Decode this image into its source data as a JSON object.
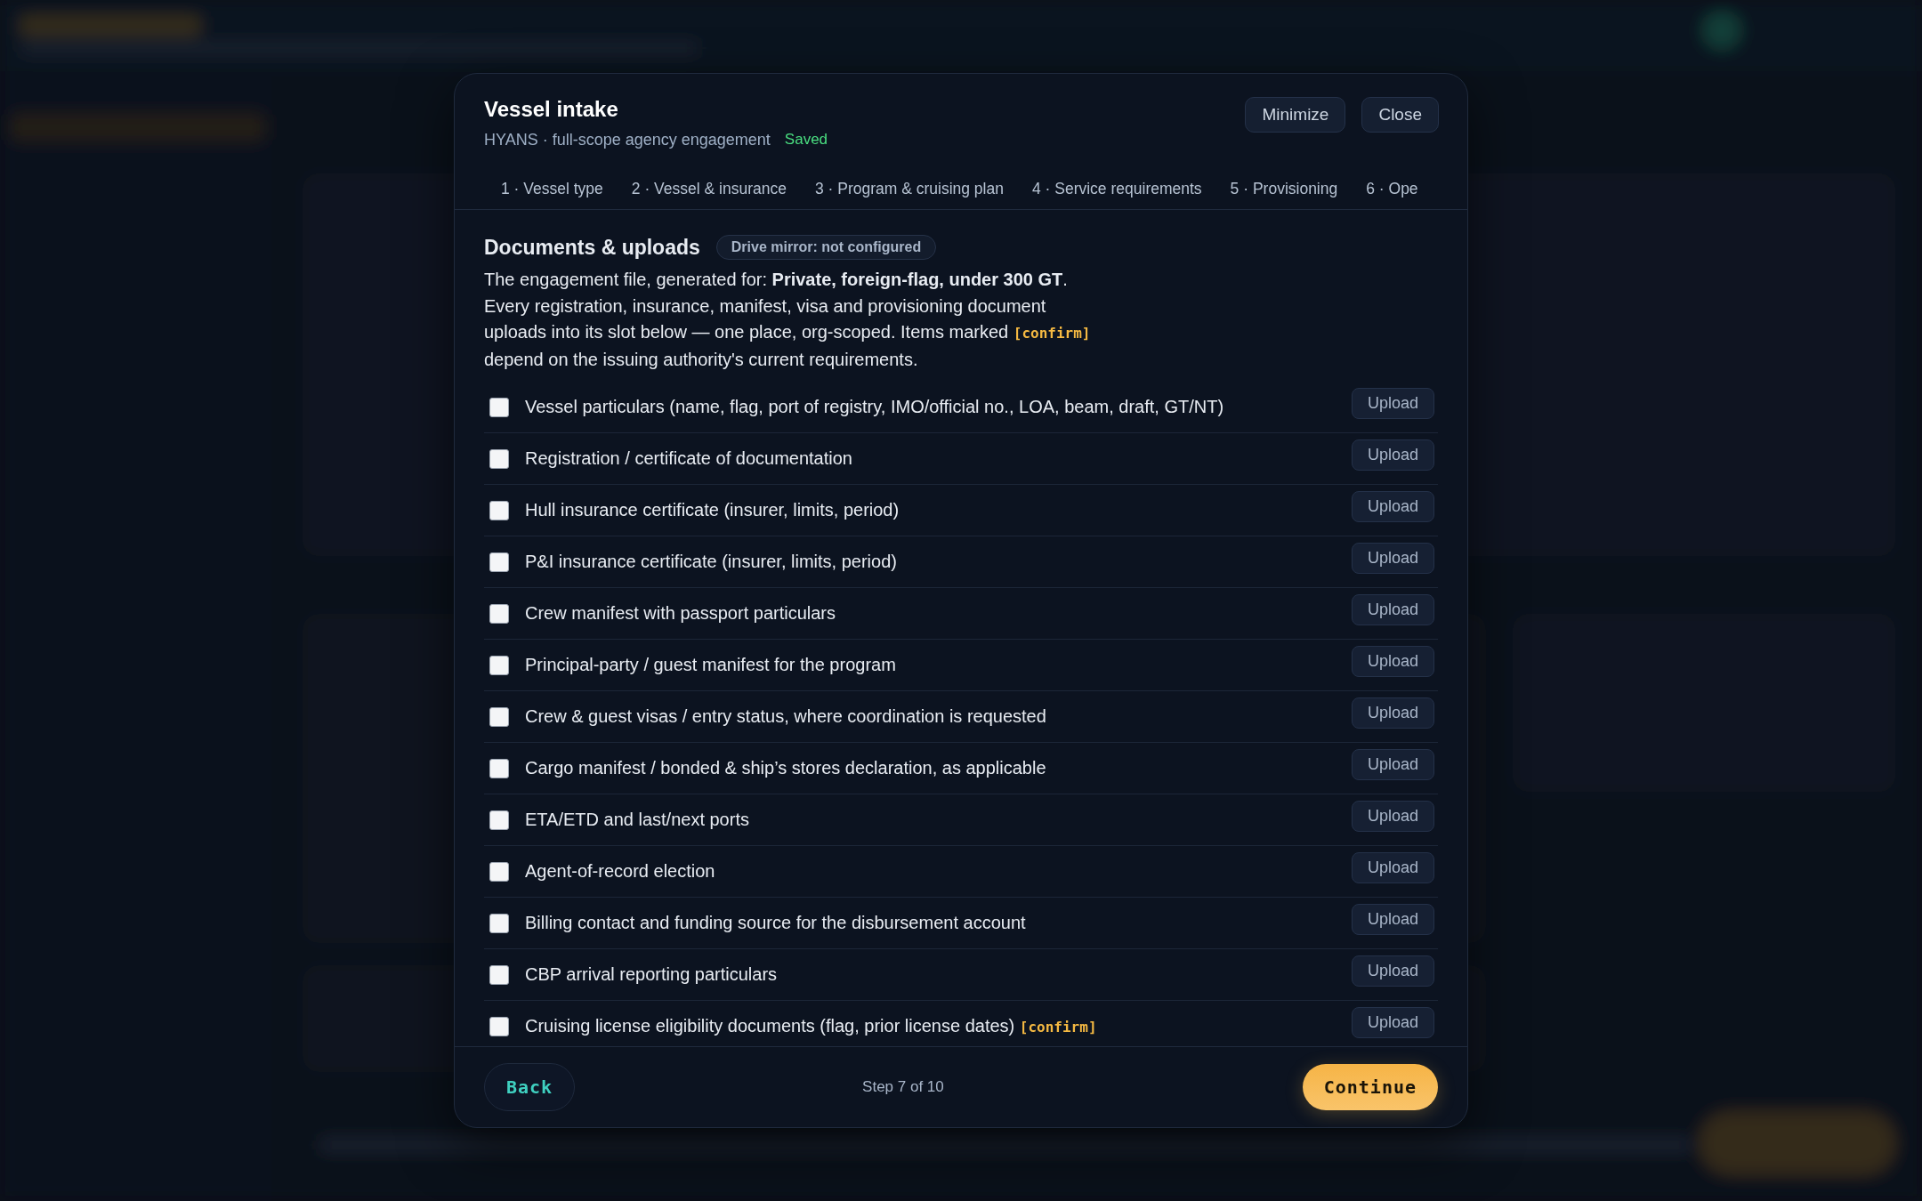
{
  "modal": {
    "title": "Vessel intake",
    "subtitle": "HYANS · full-scope agency engagement",
    "save_status": "Saved",
    "buttons": [
      "Minimize",
      "Close"
    ]
  },
  "tabs": [
    {
      "label": "1 · Vessel type",
      "selected": false
    },
    {
      "label": "2 · Vessel & insurance",
      "selected": false
    },
    {
      "label": "3 · Program & cruising plan",
      "selected": false
    },
    {
      "label": "4 · Service requirements",
      "selected": false
    },
    {
      "label": "5 · Provisioning",
      "selected": false
    },
    {
      "label": "6 · Ope",
      "selected": false
    }
  ],
  "section": {
    "title": "Documents & uploads",
    "badge": "Drive mirror: not configured",
    "description": {
      "before": "The engagement file, generated for: **Private, foreign-flag, under 300 GT**.\nEvery registration, insurance, manifest, visa and provisioning document\nuploads into its slot below — one place, org-scoped. Items marked ",
      "tag": "[confirm]",
      "after": "\ndepend on the issuing authority's current requirements."
    }
  },
  "documents": [
    {
      "label": "Vessel particulars (name, flag, port of registry, IMO/official no., LOA, beam, draft, GT/NT)",
      "checked": false,
      "button": "Upload"
    },
    {
      "label": "Registration / certificate of documentation",
      "checked": false,
      "button": "Upload"
    },
    {
      "label": "Hull insurance certificate (insurer, limits, period)",
      "checked": false,
      "button": "Upload"
    },
    {
      "label": "P&I insurance certificate (insurer, limits, period)",
      "checked": false,
      "button": "Upload"
    },
    {
      "label": "Crew manifest with passport particulars",
      "checked": false,
      "button": "Upload"
    },
    {
      "label": "Principal-party / guest manifest for the program",
      "checked": false,
      "button": "Upload"
    },
    {
      "label": "Crew & guest visas / entry status, where coordination is requested",
      "checked": false,
      "button": "Upload"
    },
    {
      "label": "Cargo manifest / bonded & ship’s stores declaration, as applicable",
      "checked": false,
      "button": "Upload"
    },
    {
      "label": "ETA/ETD and last/next ports",
      "checked": false,
      "button": "Upload"
    },
    {
      "label": "Agent-of-record election",
      "checked": false,
      "button": "Upload"
    },
    {
      "label": "Billing contact and funding source for the disbursement account",
      "checked": false,
      "button": "Upload"
    },
    {
      "label": "CBP arrival reporting particulars",
      "checked": false,
      "button": "Upload"
    },
    {
      "label": "Cruising license eligibility documents (flag, prior license dates)",
      "tag": "[confirm]",
      "checked": false,
      "button": "Upload"
    }
  ],
  "footer": {
    "back": "Back",
    "step": "Step 7 of 10",
    "continue": "Continue"
  }
}
